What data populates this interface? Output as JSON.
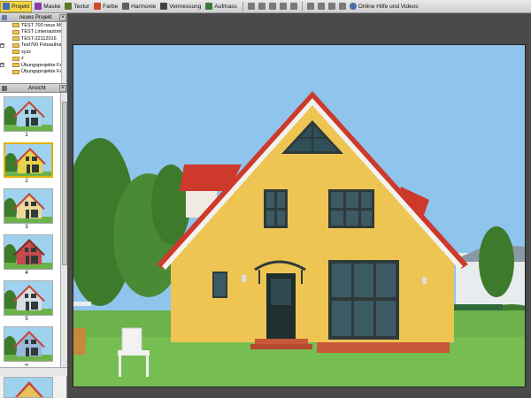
{
  "toolbar": {
    "items": [
      {
        "label": "Projekt",
        "icon": "project-icon",
        "active": true,
        "color": "#3a6fb5"
      },
      {
        "label": "Maske",
        "icon": "mask-icon",
        "active": false,
        "color": "#8a3aa8"
      },
      {
        "label": "Textur",
        "icon": "texture-icon",
        "active": false,
        "color": "#5a7a2a"
      },
      {
        "label": "Farbe",
        "icon": "color-icon",
        "active": false,
        "color": "#d24a2a"
      },
      {
        "label": "Harmonie",
        "icon": "harmony-icon",
        "active": false,
        "color": "#5f5f5f"
      },
      {
        "label": "Vermessung",
        "icon": "measure-icon",
        "active": false,
        "color": "#444444"
      },
      {
        "label": "Aufmass",
        "icon": "quantity-icon",
        "active": false,
        "color": "#3b7a3b"
      }
    ],
    "help_label": "Online Hilfe und Videos"
  },
  "project_panel": {
    "title": "neues Projekt",
    "tree": [
      {
        "label": "TEST 700 neue Mu"
      },
      {
        "label": "TEST Linienautom"
      },
      {
        "label": "TEST-22112016"
      },
      {
        "label": "Test700 Fotoaufna"
      },
      {
        "label": "xyzz"
      },
      {
        "label": "z"
      },
      {
        "label": "Übungsprojekte Fa"
      },
      {
        "label": "Übungsprojekte Fa"
      }
    ]
  },
  "views_panel": {
    "title": "Ansicht",
    "thumbnails": [
      {
        "label": "1",
        "wall": "#a9d3e6",
        "roof": "#c8463a",
        "selected": false
      },
      {
        "label": "2",
        "wall": "#e7d24a",
        "roof": "#c8463a",
        "selected": true
      },
      {
        "label": "3",
        "wall": "#ecd79a",
        "roof": "#b84a3a",
        "selected": false
      },
      {
        "label": "4",
        "wall": "#c84a4a",
        "roof": "#7a2f2a",
        "selected": false
      },
      {
        "label": "5",
        "wall": "#d9dde3",
        "roof": "#c8463a",
        "selected": false
      },
      {
        "label": "∞",
        "wall": "#9ab8d8",
        "roof": "#c8463a",
        "selected": false
      },
      {
        "label": "6",
        "wall": "#d9dde3",
        "roof": "#c8463a",
        "selected": false
      }
    ]
  },
  "photo": {
    "sky": "#8fc4ec",
    "wall": "#eec553",
    "roof": "#cd3a2c",
    "frame": "#2e3a3a",
    "grass": "#6bb24a"
  }
}
